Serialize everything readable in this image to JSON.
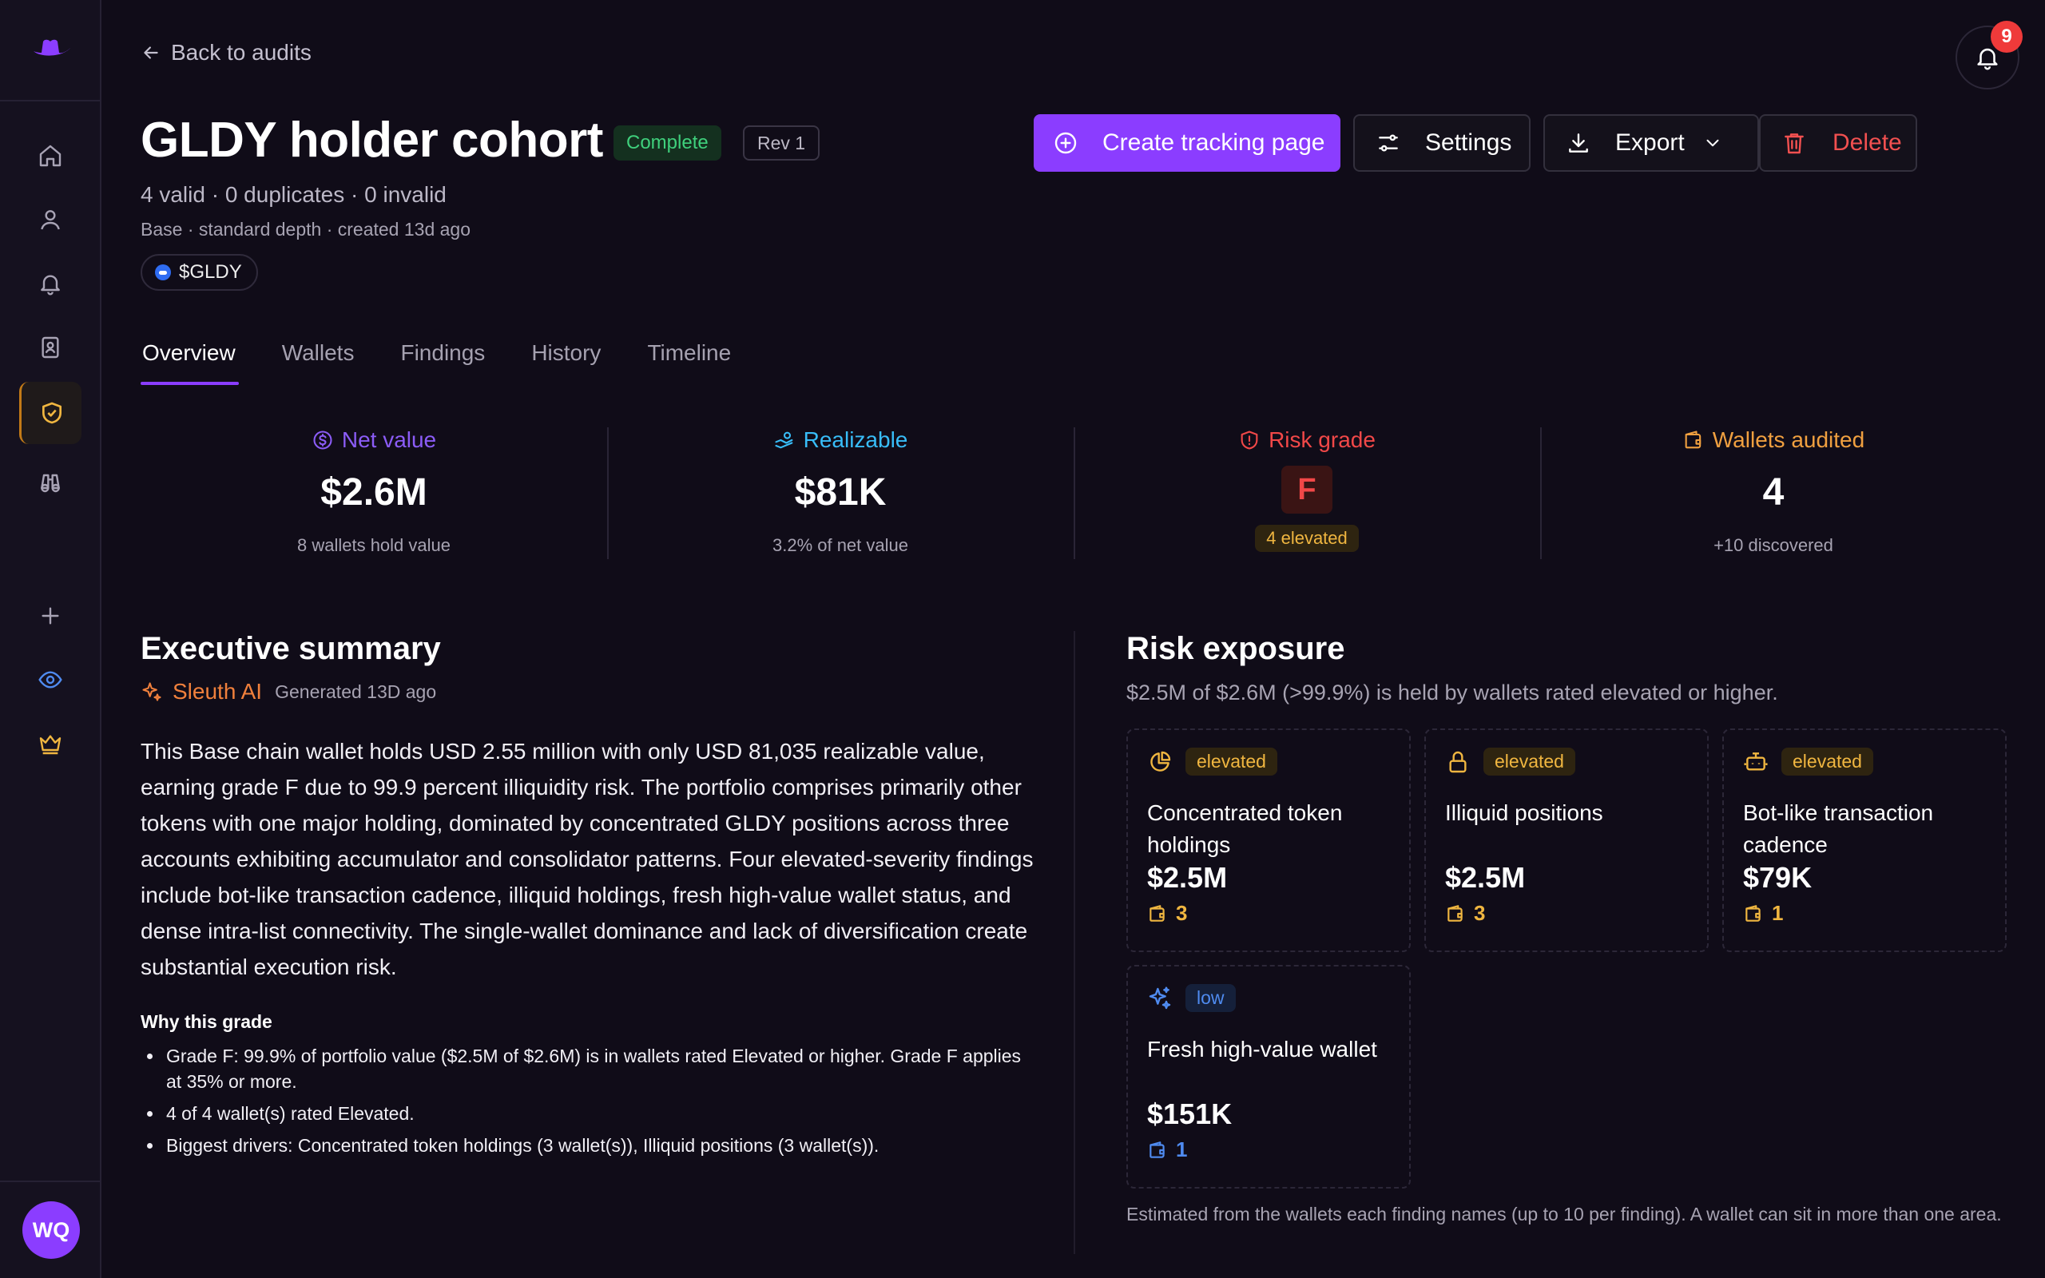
{
  "colors": {
    "accent": "#8b3dff",
    "net_value": "#8b5cf6",
    "realizable": "#38bdf8",
    "risk": "#f14848",
    "wallets": "#f0a040",
    "elevated": "#f0b640",
    "low": "#4f8bf0",
    "success": "#3fd07c"
  },
  "sidebar": {
    "items": [
      "home-icon",
      "user-icon",
      "bell-icon",
      "contacts-icon",
      "shield-check-icon",
      "binoculars-icon",
      "plus-icon",
      "eye-icon",
      "crown-icon"
    ],
    "active": "shield-check-icon",
    "avatar_initials": "WQ"
  },
  "header": {
    "back_label": "Back to audits",
    "notification_count": "9",
    "title": "GLDY holder cohort",
    "status_badge": "Complete",
    "revision_badge": "Rev 1",
    "counts": "4 valid · 0 duplicates · 0 invalid",
    "meta": "Base · standard depth · created 13d ago",
    "token": "$GLDY"
  },
  "actions": {
    "create": "Create tracking page",
    "settings": "Settings",
    "export": "Export",
    "delete": "Delete"
  },
  "tabs": [
    {
      "label": "Overview",
      "active": true
    },
    {
      "label": "Wallets",
      "active": false
    },
    {
      "label": "Findings",
      "active": false
    },
    {
      "label": "History",
      "active": false
    },
    {
      "label": "Timeline",
      "active": false
    }
  ],
  "stats": {
    "net_value": {
      "label": "Net value",
      "value": "$2.6M",
      "sub": "8 wallets hold value"
    },
    "realizable": {
      "label": "Realizable",
      "value": "$81K",
      "sub": "3.2% of net value"
    },
    "risk_grade": {
      "label": "Risk grade",
      "value": "F",
      "sub": "4 elevated"
    },
    "wallets_audited": {
      "label": "Wallets audited",
      "value": "4",
      "sub": "+10 discovered"
    }
  },
  "summary": {
    "heading": "Executive summary",
    "ai_name": "Sleuth AI",
    "generated": "Generated 13D ago",
    "body": "This Base chain wallet holds USD 2.55 million with only USD 81,035 realizable value, earning grade F due to 99.9 percent illiquidity risk. The portfolio comprises primarily other tokens with one major holding, dominated by concentrated GLDY positions across three accounts exhibiting accumulator and consolidator patterns. Four elevated-severity findings include bot-like transaction cadence, illiquid holdings, fresh high-value wallet status, and dense intra-list connectivity. The single-wallet dominance and lack of diversification create substantial execution risk.",
    "why_title": "Why this grade",
    "why_items": [
      "Grade F: 99.9% of portfolio value ($2.5M of $2.6M) is in wallets rated Elevated or higher. Grade F applies at 35% or more.",
      "4 of 4 wallet(s) rated Elevated.",
      "Biggest drivers: Concentrated token holdings (3 wallet(s)), Illiquid positions (3 wallet(s))."
    ]
  },
  "risk": {
    "heading": "Risk exposure",
    "subtitle": "$2.5M of $2.6M (>99.9%) is held by wallets rated elevated or higher.",
    "cards": [
      {
        "icon": "pie-chart-icon",
        "severity": "elevated",
        "title": "Concentrated token holdings",
        "value": "$2.5M",
        "wallets": "3"
      },
      {
        "icon": "lock-icon",
        "severity": "elevated",
        "title": "Illiquid positions",
        "value": "$2.5M",
        "wallets": "3"
      },
      {
        "icon": "bot-icon",
        "severity": "elevated",
        "title": "Bot-like transaction cadence",
        "value": "$79K",
        "wallets": "1"
      },
      {
        "icon": "sparkles-icon",
        "severity": "low",
        "title": "Fresh high-value wallet",
        "value": "$151K",
        "wallets": "1"
      }
    ],
    "note": "Estimated from the wallets each finding names (up to 10 per finding). A wallet can sit in more than one area."
  }
}
